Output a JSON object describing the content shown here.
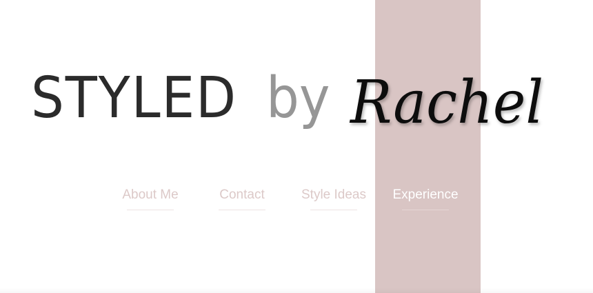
{
  "logo": {
    "word_styled": "STYLED",
    "word_by": "by",
    "word_script": "Rachel"
  },
  "nav": {
    "items": [
      {
        "label": "About Me"
      },
      {
        "label": "Contact"
      },
      {
        "label": "Style Ideas"
      },
      {
        "label": "Experience",
        "active": true
      }
    ]
  },
  "colors": {
    "accent_column": "#d9c5c4",
    "nav_text": "#dcc9c8",
    "nav_active_text": "#ffffff",
    "logo_dark": "#2b2b2b",
    "logo_gray": "#969696",
    "script_ink": "#111111"
  }
}
